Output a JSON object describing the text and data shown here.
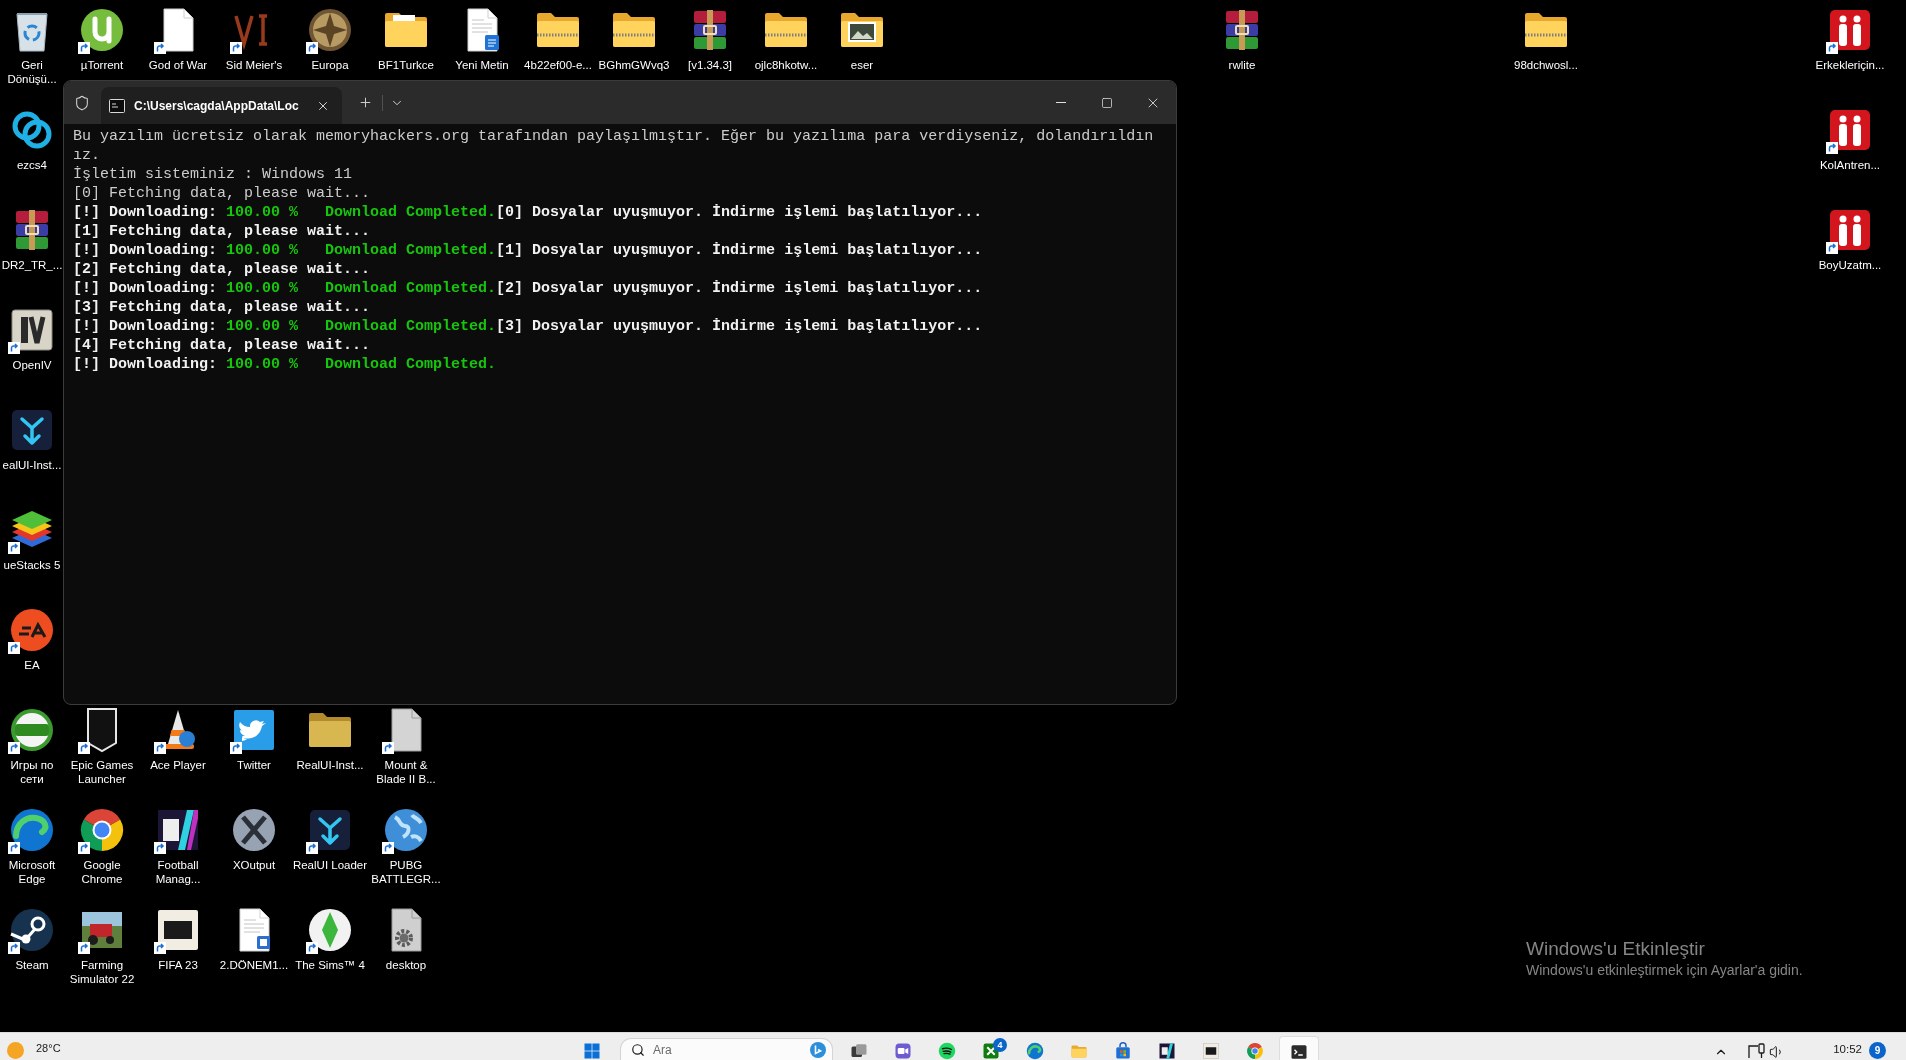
{
  "desktop_icons": [
    {
      "label": [
        "Geri",
        "Dönüşü..."
      ],
      "shortcut": false
    },
    {
      "label": [
        "µTorrent"
      ],
      "shortcut": true
    },
    {
      "label": [
        "God of War"
      ],
      "shortcut": true
    },
    {
      "label": [
        "Sid Meier's"
      ],
      "shortcut": true
    },
    {
      "label": [
        "Europa"
      ],
      "shortcut": true
    },
    {
      "label": [
        "BF1Turkce"
      ],
      "shortcut": false
    },
    {
      "label": [
        "Yeni Metin"
      ],
      "shortcut": false
    },
    {
      "label": [
        "4b22ef00-e..."
      ],
      "shortcut": false
    },
    {
      "label": [
        "BGhmGWvq3"
      ],
      "shortcut": false
    },
    {
      "label": [
        "[v1.34.3]"
      ],
      "shortcut": false
    },
    {
      "label": [
        "ojlc8hkotw..."
      ],
      "shortcut": false
    },
    {
      "label": [
        "eser"
      ],
      "shortcut": false
    },
    {
      "label": [
        "rwlite"
      ],
      "shortcut": false
    },
    {
      "label": [
        "98dchwosl..."
      ],
      "shortcut": false
    },
    {
      "label": [
        "Erkekleriçin..."
      ],
      "shortcut": true
    },
    {
      "label": [
        "ezcs4"
      ],
      "shortcut": false
    },
    {
      "label": [
        "KolAntren..."
      ],
      "shortcut": true
    },
    {
      "label": [
        "DR2_TR_..."
      ],
      "shortcut": false
    },
    {
      "label": [
        "BoyUzatm..."
      ],
      "shortcut": true
    },
    {
      "label": [
        "OpenIV"
      ],
      "shortcut": true
    },
    {
      "label": [
        "ealUI-Inst..."
      ],
      "shortcut": false
    },
    {
      "label": [
        "ueStacks 5"
      ],
      "shortcut": true
    },
    {
      "label": [
        "EA"
      ],
      "shortcut": true
    },
    {
      "label": [
        "Игры по",
        "сети"
      ],
      "shortcut": true
    },
    {
      "label": [
        "Epic Games",
        "Launcher"
      ],
      "shortcut": true
    },
    {
      "label": [
        "Ace Player"
      ],
      "shortcut": true
    },
    {
      "label": [
        "Twitter"
      ],
      "shortcut": true
    },
    {
      "label": [
        "RealUI-Inst..."
      ],
      "shortcut": false
    },
    {
      "label": [
        "Mount &",
        "Blade II B..."
      ],
      "shortcut": true
    },
    {
      "label": [
        "Microsoft",
        "Edge"
      ],
      "shortcut": true
    },
    {
      "label": [
        "Google",
        "Chrome"
      ],
      "shortcut": true
    },
    {
      "label": [
        "Football",
        "Manag..."
      ],
      "shortcut": true
    },
    {
      "label": [
        "XOutput"
      ],
      "shortcut": false
    },
    {
      "label": [
        "RealUI Loader"
      ],
      "shortcut": true
    },
    {
      "label": [
        "PUBG",
        "BATTLEGR..."
      ],
      "shortcut": true
    },
    {
      "label": [
        "Steam"
      ],
      "shortcut": true
    },
    {
      "label": [
        "Farming",
        "Simulator 22"
      ],
      "shortcut": true
    },
    {
      "label": [
        "FIFA 23"
      ],
      "shortcut": true
    },
    {
      "label": [
        "2.DÖNEM1..."
      ],
      "shortcut": false
    },
    {
      "label": [
        "The Sims™ 4"
      ],
      "shortcut": true
    },
    {
      "label": [
        "desktop"
      ],
      "shortcut": false
    }
  ],
  "terminal_window": {
    "tabs": [
      {
        "title": "C:\\Users\\cagda\\AppData\\Loc",
        "selected": true
      }
    ],
    "lines": [
      {
        "segments": [
          {
            "text": "Bu yazılım ücretsiz olarak memoryhackers.org tarafından paylaşılmıştır. Eğer bu yazılıma para verdiyseniz, dolandırıldınız.",
            "kind": "normal"
          }
        ]
      },
      {
        "segments": [
          {
            "text": "İşletim sisteminiz : Windows 11",
            "kind": "normal"
          }
        ]
      },
      {
        "segments": [
          {
            "text": "[0] Fetching data, please wait...",
            "kind": "normal"
          }
        ]
      },
      {
        "segments": [
          {
            "text": "[!] Downloading: ",
            "kind": "bright"
          },
          {
            "text": "100.00 %   Download Completed.",
            "kind": "success"
          },
          {
            "text": "[0] Dosyalar uyuşmuyor. İndirme işlemi başlatılıyor...",
            "kind": "bright"
          }
        ]
      },
      {
        "segments": [
          {
            "text": "[1] Fetching data, please wait...",
            "kind": "bright"
          }
        ]
      },
      {
        "segments": [
          {
            "text": "[!] Downloading: ",
            "kind": "bright"
          },
          {
            "text": "100.00 %   Download Completed.",
            "kind": "success"
          },
          {
            "text": "[1] Dosyalar uyuşmuyor. İndirme işlemi başlatılıyor...",
            "kind": "bright"
          }
        ]
      },
      {
        "segments": [
          {
            "text": "[2] Fetching data, please wait...",
            "kind": "bright"
          }
        ]
      },
      {
        "segments": [
          {
            "text": "[!] Downloading: ",
            "kind": "bright"
          },
          {
            "text": "100.00 %   Download Completed.",
            "kind": "success"
          },
          {
            "text": "[2] Dosyalar uyuşmuyor. İndirme işlemi başlatılıyor...",
            "kind": "bright"
          }
        ]
      },
      {
        "segments": [
          {
            "text": "[3] Fetching data, please wait...",
            "kind": "bright"
          }
        ]
      },
      {
        "segments": [
          {
            "text": "[!] Downloading: ",
            "kind": "bright"
          },
          {
            "text": "100.00 %   Download Completed.",
            "kind": "success"
          },
          {
            "text": "[3] Dosyalar uyuşmuyor. İndirme işlemi başlatılıyor...",
            "kind": "bright"
          }
        ]
      },
      {
        "segments": [
          {
            "text": "[4] Fetching data, please wait...",
            "kind": "bright"
          }
        ]
      },
      {
        "segments": [
          {
            "text": "[!] Downloading: ",
            "kind": "bright"
          },
          {
            "text": "100.00 %   Download Completed.",
            "kind": "success"
          }
        ]
      }
    ]
  },
  "activation_notice": {
    "title": "Windows'u Etkinleştir",
    "message": "Windows'u etkinleştirmek için Ayarlar'a gidin."
  },
  "taskbar": {
    "weather": {
      "temperature": "28°C"
    },
    "search": {
      "placeholder": "Ara"
    },
    "apps": [
      {
        "selected": false
      },
      {
        "selected": false
      },
      {
        "selected": false
      },
      {
        "selected": false,
        "badge": "4"
      },
      {
        "selected": false
      },
      {
        "selected": false
      },
      {
        "selected": false
      },
      {
        "selected": false
      },
      {
        "selected": false
      },
      {
        "selected": false
      },
      {
        "selected": true
      }
    ],
    "clock": {
      "time": "10:52"
    },
    "notifications": {
      "count": "9"
    }
  }
}
